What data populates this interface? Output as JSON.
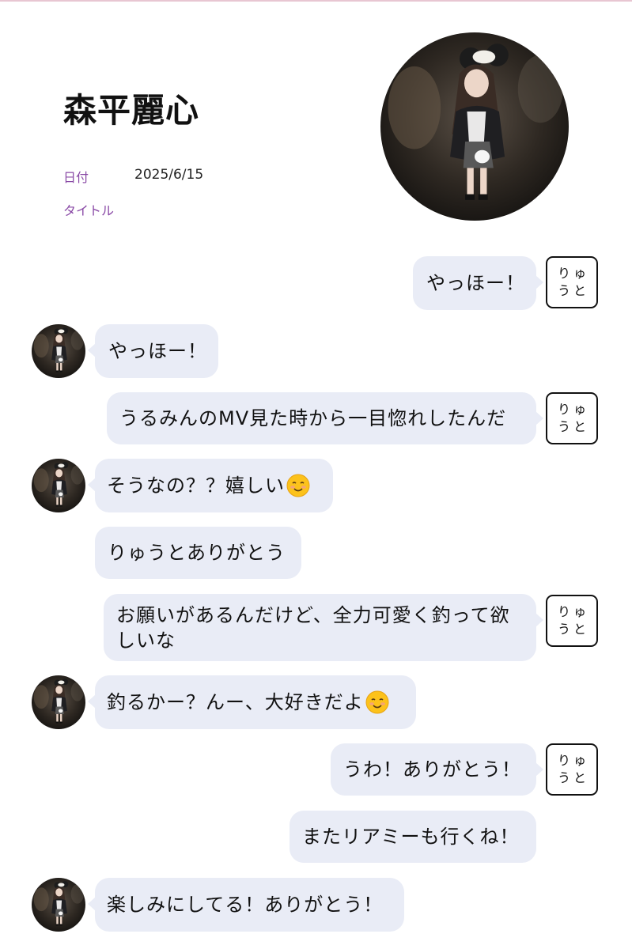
{
  "header": {
    "name": "森平麗心",
    "date_label": "日付",
    "date_value": "2025/6/15",
    "title_label": "タイトル",
    "title_value": ""
  },
  "user_badge_label": "りゅ\nうと",
  "colors": {
    "bubble": "#e9ecf6",
    "label_purple": "#8a4aa6",
    "top_line": "#e8c6d2"
  },
  "messages": [
    {
      "side": "right",
      "text": "やっほー！"
    },
    {
      "side": "left",
      "text": "やっほー！"
    },
    {
      "side": "right",
      "text": "うるみんのMV見た時から一目惚れしたんだ"
    },
    {
      "side": "left",
      "text": "そうなの？？嬉しい",
      "emoji": "smiling-face-icon"
    },
    {
      "side": "left",
      "text": "りゅうとありがとう"
    },
    {
      "side": "right",
      "text": "お願いがあるんだけど、全力可愛く釣って欲しいな"
    },
    {
      "side": "left",
      "text": "釣るかー？んー、大好きだよ",
      "emoji": "smiling-face-icon"
    },
    {
      "side": "right",
      "text": "うわ！ありがとう！"
    },
    {
      "side": "right",
      "text": "またリアミーも行くね！"
    },
    {
      "side": "left",
      "text": "楽しみにしてる！ありがとう！"
    }
  ]
}
